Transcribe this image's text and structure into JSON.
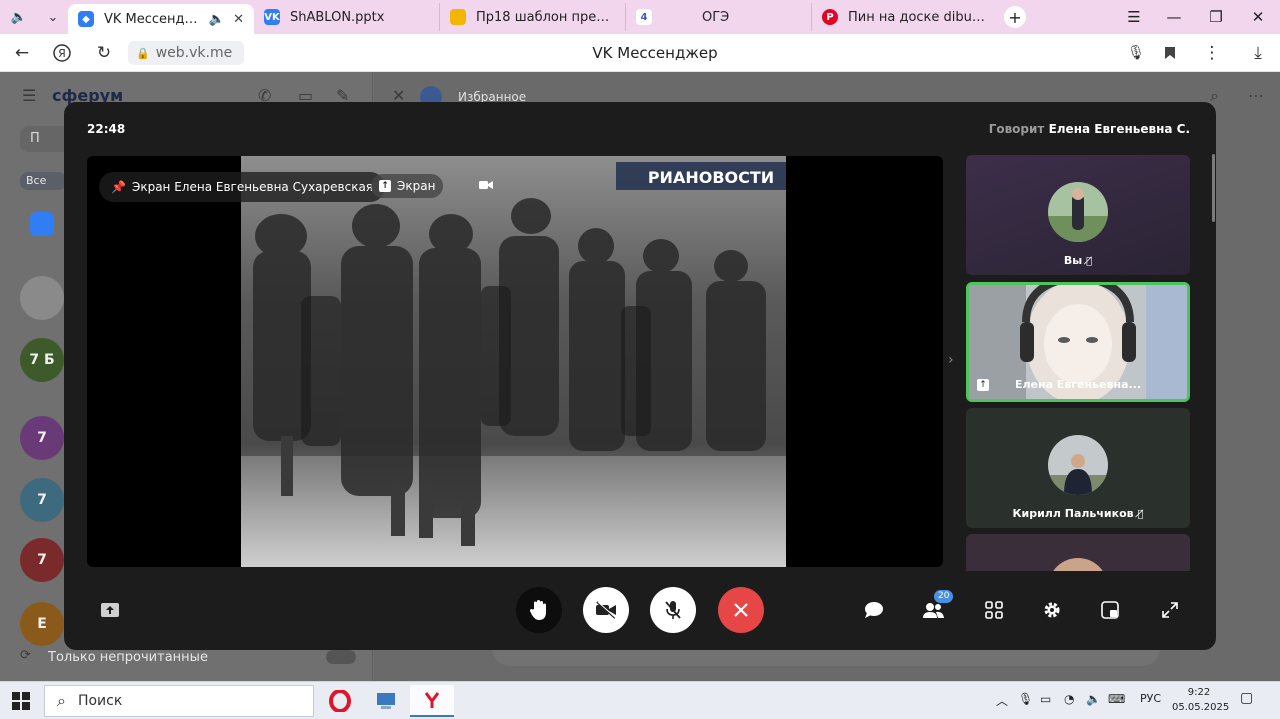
{
  "browser": {
    "tabs": [
      {
        "title": "VK Мессенджер",
        "favicon_color": "#2f7ef5",
        "active": true
      },
      {
        "title": "ShABLON.pptx",
        "favicon_color": "#2f7ef5",
        "active": false
      },
      {
        "title": "Пр18 шаблон презентаци",
        "favicon_color": "#f4b400",
        "active": false
      },
      {
        "title": "ОГЭ",
        "favicon_color": "#3a5cd8",
        "active": false
      },
      {
        "title": "Пин на доске dibujos.para",
        "favicon_color": "#e60023",
        "active": false
      }
    ],
    "url": "web.vk.me",
    "page_title": "VK Мессенджер"
  },
  "vk": {
    "logo": "сферум",
    "search_placeholder": "П",
    "filter_all": "Все",
    "favorites_title": "Избранное",
    "chat_avatars": [
      {
        "label": "",
        "color": "#8a8a8a"
      },
      {
        "label": "7 Б",
        "color": "#3d5a2a"
      },
      {
        "label": "7",
        "color": "#6a3a78"
      },
      {
        "label": "7",
        "color": "#3e6a80"
      },
      {
        "label": "7",
        "color": "#7a2a2a"
      },
      {
        "label": "Е",
        "color": "#8a5a1a"
      }
    ],
    "only_unread": "Только непрочитанные"
  },
  "call": {
    "time": "22:48",
    "speaking_prefix": "Говорит",
    "speaking_name": "Елена Евгеньевна С.",
    "screen_owner": "Экран Елена Евгеньевна Сухаревская",
    "screen_label": "Экран",
    "watermark": "РИАНОВОСТИ",
    "participants": [
      {
        "name": "Вы",
        "muted": true,
        "bg": "#3a2f44"
      },
      {
        "name": "Елена Евгеньевна...",
        "muted": false,
        "bg": "#8a8d92",
        "active": true
      },
      {
        "name": "Кирилл Пальчиков",
        "muted": true,
        "bg": "#2a302c"
      },
      {
        "name": "",
        "muted": false,
        "bg": "#3a2e3a"
      }
    ],
    "participants_count": "20"
  },
  "taskbar": {
    "search_label": "Поиск",
    "lang": "РУС",
    "time": "9:22",
    "date": "05.05.2025"
  }
}
